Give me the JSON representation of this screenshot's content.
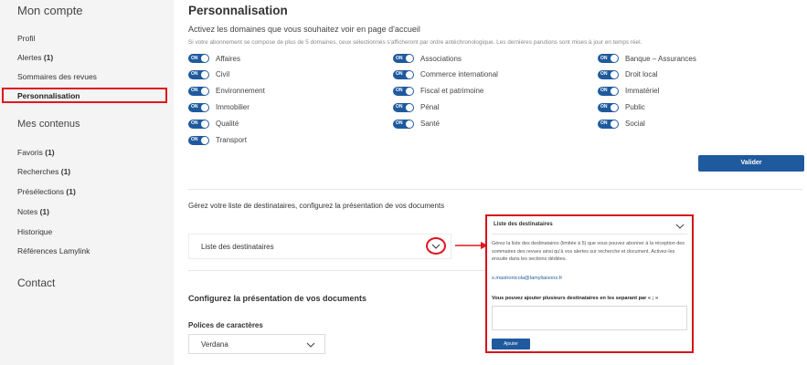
{
  "sidebar": {
    "heading_account": "Mon compte",
    "account_items": [
      {
        "label": "Profil",
        "count": ""
      },
      {
        "label": "Alertes",
        "count": "(1)"
      },
      {
        "label": "Sommaires des revues",
        "count": ""
      }
    ],
    "active_item": "Personnalisation",
    "heading_contents": "Mes contenus",
    "content_items": [
      {
        "label": "Favoris",
        "count": "(1)"
      },
      {
        "label": "Recherches",
        "count": "(1)"
      },
      {
        "label": "Présélections",
        "count": "(1)"
      },
      {
        "label": "Notes",
        "count": "(1)"
      },
      {
        "label": "Historique",
        "count": ""
      },
      {
        "label": "Références Lamylink",
        "count": ""
      }
    ],
    "heading_contact": "Contact"
  },
  "main": {
    "title": "Personnalisation",
    "subtitle": "Activez les domaines que vous souhaitez voir en page d'accueil",
    "note": "Si votre abonnement se compose de plus de 5 domaines, ceux sélectionnés s'afficheront par ordre antéchronologique. Les dernières parutions sont mises à jour en temps réel.",
    "toggle_on_text": "ON",
    "domains_col1": [
      "Affaires",
      "Civil",
      "Environnement",
      "Immobilier",
      "Qualité",
      "Transport"
    ],
    "domains_col2": [
      "Associations",
      "Commerce international",
      "Fiscal et patrimoine",
      "Pénal",
      "Santé"
    ],
    "domains_col3": [
      "Banque – Assurances",
      "Droit local",
      "Immatériel",
      "Public",
      "Social"
    ],
    "validate_label": "Valider",
    "recipients_intro": "Gérez votre liste de destinataires, configurez la présentation de vos documents",
    "recipients_label": "Liste des destinataires",
    "doc_presentation_title": "Configurez la présentation de vos documents",
    "font_label": "Polices de caractères",
    "font_selected": "Verdana"
  },
  "popup": {
    "title": "Liste des destinataires",
    "description": "Gérez la liste des destinataires (limitée à 5) que vous pouvez abonner à la réception des sommaires des revues ainsi qu'à vos alertes sur recherche et document. Activez-les ensuite dans les sections dédiées.",
    "email": "s.mastronicola@lamyliaisons.fr",
    "instruction": "Vous pouvez ajouter plusieurs destinataires en les separant par « ; »",
    "input_value": "",
    "add_label": "Ajouter"
  },
  "colors": {
    "accent": "#1f5a9e",
    "highlight": "#e0161e"
  }
}
